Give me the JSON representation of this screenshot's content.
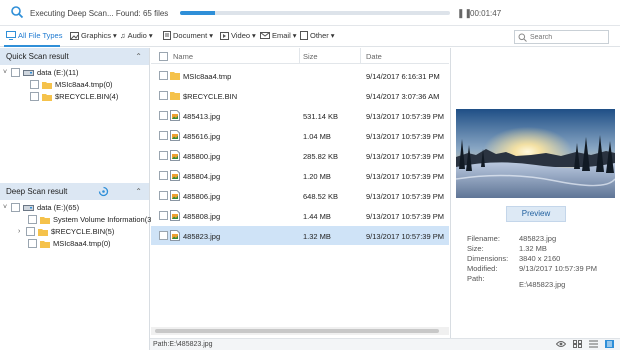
{
  "scan": {
    "status_text": "Executing Deep Scan... Found: 65 files",
    "progress_fraction": 0.13,
    "elapsed": "00:01:47"
  },
  "filetypes": [
    {
      "label": "All File Types",
      "icon": "monitor-icon",
      "active": true
    },
    {
      "label": "Graphics",
      "icon": "image-icon",
      "dropdown": true
    },
    {
      "label": "Audio",
      "icon": "music-note-icon",
      "dropdown": true
    },
    {
      "label": "Document",
      "icon": "document-icon",
      "dropdown": true
    },
    {
      "label": "Video",
      "icon": "video-icon",
      "dropdown": true
    },
    {
      "label": "Email",
      "icon": "envelope-icon",
      "dropdown": true
    },
    {
      "label": "Other",
      "icon": "other-icon",
      "dropdown": true
    }
  ],
  "search": {
    "placeholder": "Search"
  },
  "quick_scan": {
    "title": "Quick Scan result",
    "tree": [
      {
        "label": "data (E:)(11)",
        "type": "drive"
      },
      {
        "label": "MSIc8aa4.tmp(0)",
        "type": "folder"
      },
      {
        "label": "$RECYCLE.BIN(4)",
        "type": "folder"
      }
    ]
  },
  "deep_scan": {
    "title": "Deep Scan result",
    "tree": [
      {
        "label": "data (E:)(65)",
        "type": "drive"
      },
      {
        "label": "System Volume Information(3)",
        "type": "folder"
      },
      {
        "label": "$RECYCLE.BIN(5)",
        "type": "folder"
      },
      {
        "label": "MSIc8aa4.tmp(0)",
        "type": "folder"
      }
    ]
  },
  "columns": {
    "name": "Name",
    "size": "Size",
    "date": "Date"
  },
  "files": [
    {
      "name": "MSIc8aa4.tmp",
      "size": "",
      "date": "9/14/2017 6:16:31 PM",
      "type": "folder",
      "selected": false
    },
    {
      "name": "$RECYCLE.BIN",
      "size": "",
      "date": "9/14/2017 3:07:36 AM",
      "type": "folder",
      "selected": false
    },
    {
      "name": "485413.jpg",
      "size": "531.14 KB",
      "date": "9/13/2017 10:57:39 PM",
      "type": "image",
      "selected": false
    },
    {
      "name": "485616.jpg",
      "size": "1.04 MB",
      "date": "9/13/2017 10:57:39 PM",
      "type": "image",
      "selected": false
    },
    {
      "name": "485800.jpg",
      "size": "285.82 KB",
      "date": "9/13/2017 10:57:39 PM",
      "type": "image",
      "selected": false
    },
    {
      "name": "485804.jpg",
      "size": "1.20 MB",
      "date": "9/13/2017 10:57:39 PM",
      "type": "image",
      "selected": false
    },
    {
      "name": "485806.jpg",
      "size": "648.52 KB",
      "date": "9/13/2017 10:57:39 PM",
      "type": "image",
      "selected": false
    },
    {
      "name": "485808.jpg",
      "size": "1.44 MB",
      "date": "9/13/2017 10:57:39 PM",
      "type": "image",
      "selected": false
    },
    {
      "name": "485823.jpg",
      "size": "1.32 MB",
      "date": "9/13/2017 10:57:39 PM",
      "type": "image",
      "selected": true
    }
  ],
  "preview": {
    "button_label": "Preview",
    "meta": [
      {
        "key": "Filename:",
        "value": "485823.jpg"
      },
      {
        "key": "Size:",
        "value": "1.32 MB"
      },
      {
        "key": "Dimensions:",
        "value": "3840 x 2160"
      },
      {
        "key": "Modified:",
        "value": "9/13/2017 10:57:39 PM"
      },
      {
        "key": "Path:",
        "value": "E:\\485823.jpg"
      }
    ]
  },
  "statusbar": {
    "path_text": "Path:E:\\485823.jpg"
  },
  "colors": {
    "accent": "#2f8fd8",
    "pane_header": "#dce7f3",
    "selected_row": "#cfe3f7"
  }
}
